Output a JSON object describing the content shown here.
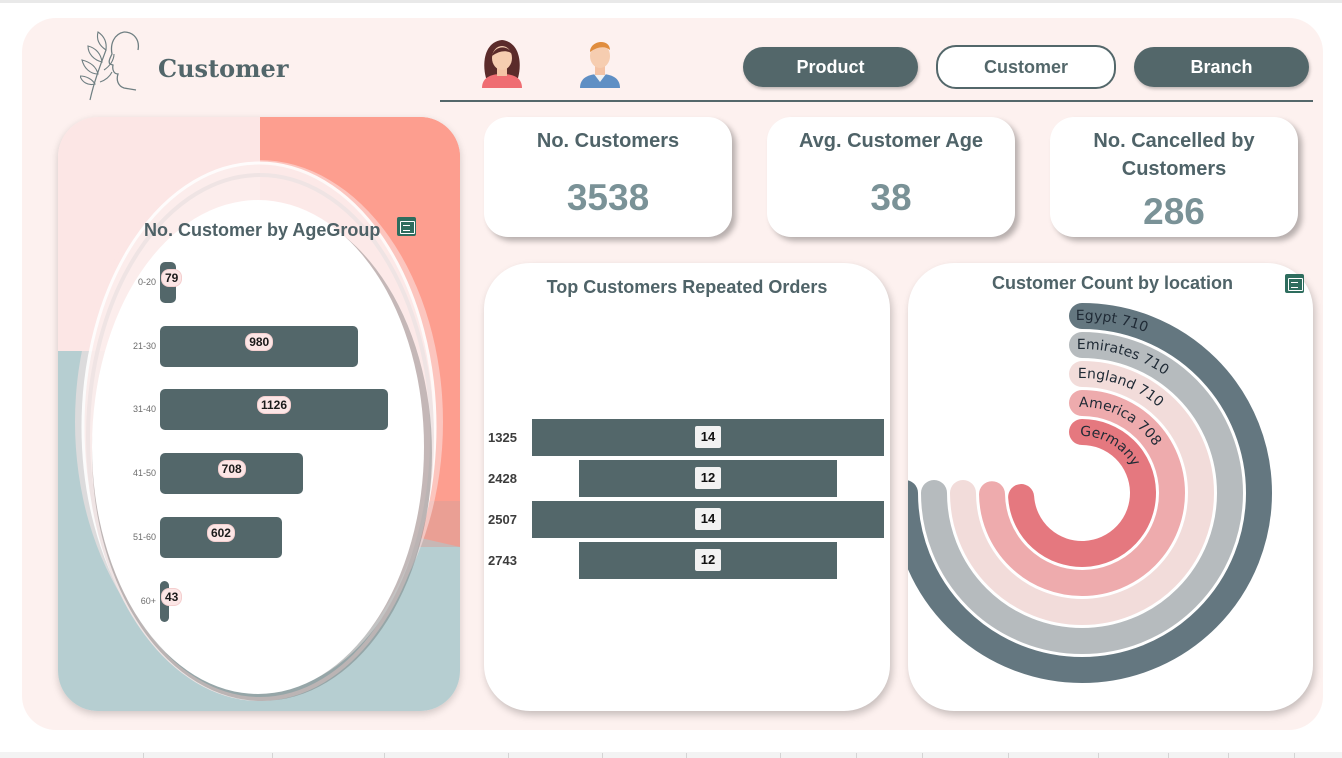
{
  "header": {
    "title": "Customer",
    "nav": [
      {
        "label": "Product",
        "active": false
      },
      {
        "label": "Customer",
        "active": true
      },
      {
        "label": "Branch",
        "active": false
      }
    ]
  },
  "kpis": [
    {
      "title": "No. Customers",
      "value": "3538"
    },
    {
      "title": "Avg. Customer Age",
      "value": "38"
    },
    {
      "title": "No. Cancelled by Customers",
      "value": "286"
    }
  ],
  "colors": {
    "primary": "#53676a",
    "background": "#fdf1ef",
    "accent_salmon": "#fd9b8b",
    "accent_blue": "#b6ced1",
    "kpi_value": "#7a9297"
  },
  "icons": [
    "woman-avatar-icon",
    "man-avatar-icon",
    "leaf-face-logo",
    "focus-mode-icon"
  ],
  "chart_data": [
    {
      "type": "bar",
      "orientation": "horizontal",
      "title": "No. Customer by AgeGroup",
      "categories": [
        "0-20",
        "21-30",
        "31-40",
        "41-50",
        "51-60",
        "60+"
      ],
      "values": [
        79,
        980,
        1126,
        708,
        602,
        43
      ]
    },
    {
      "type": "bar",
      "orientation": "horizontal",
      "style": "funnel",
      "title": "Top Customers Repeated Orders",
      "categories": [
        "1325",
        "2428",
        "2507",
        "2743"
      ],
      "values": [
        14,
        12,
        14,
        12
      ]
    },
    {
      "type": "radial-bar",
      "title": "Customer Count by location",
      "categories": [
        "Egypt",
        "Emirates",
        "England",
        "America",
        "Germany"
      ],
      "values": [
        710,
        710,
        710,
        708,
        700
      ],
      "series_colors": [
        "#647780",
        "#b6bbbe",
        "#f2dcda",
        "#eeabad",
        "#e5787f"
      ]
    }
  ]
}
